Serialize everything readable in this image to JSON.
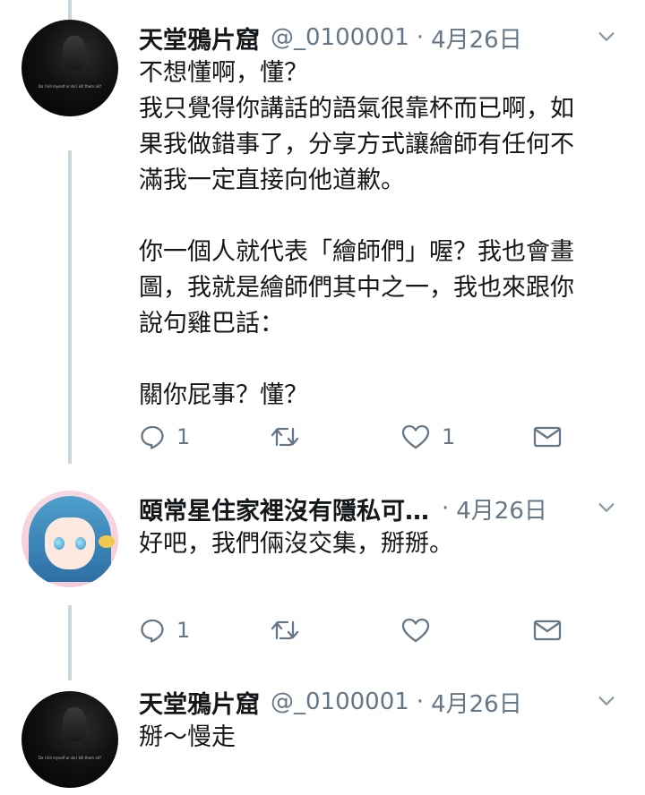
{
  "tweets": [
    {
      "name": "天堂鴉片窟",
      "handle": "@_0100001",
      "separator": "·",
      "date": "4月26日",
      "avatar": "dark-portrait-avatar",
      "avatar_caption": "Do I kill myself or do I kill them all?",
      "paragraphs": [
        [
          "不想懂啊，懂？",
          "我只覺得你講話的語氣很靠杯而已啊，如",
          "果我做錯事了，分享方式讓繪師有任何不",
          "滿我一定直接向他道歉。"
        ],
        [
          "你一個人就代表「繪師們」喔？我也會畫",
          "圖，我就是繪師們其中之一，我也來跟你",
          "說句雞巴話："
        ],
        [
          "關你屁事？懂？"
        ]
      ],
      "reply_count": "1",
      "retweet_count": "",
      "like_count": "1"
    },
    {
      "name": "頤常星住家裡沒有隱私可…",
      "handle": "",
      "separator": "·",
      "date": "4月26日",
      "avatar": "anime-girl-avatar",
      "paragraphs": [
        [
          "好吧，我們倆沒交集，掰掰。"
        ]
      ],
      "reply_count": "1",
      "retweet_count": "",
      "like_count": ""
    },
    {
      "name": "天堂鴉片窟",
      "handle": "@_0100001",
      "separator": "·",
      "date": "4月26日",
      "avatar": "dark-portrait-avatar",
      "avatar_caption": "Do I kill myself or do I kill them all?",
      "paragraphs": [
        [
          "掰～慢走"
        ]
      ]
    }
  ],
  "icons": {
    "reply": "reply-icon",
    "retweet": "retweet-icon",
    "like": "heart-icon",
    "dm": "envelope-icon",
    "menu": "chevron-down-icon"
  },
  "colors": {
    "text": "#14171a",
    "secondary": "#657786",
    "thread_line": "#ccd6dd"
  }
}
